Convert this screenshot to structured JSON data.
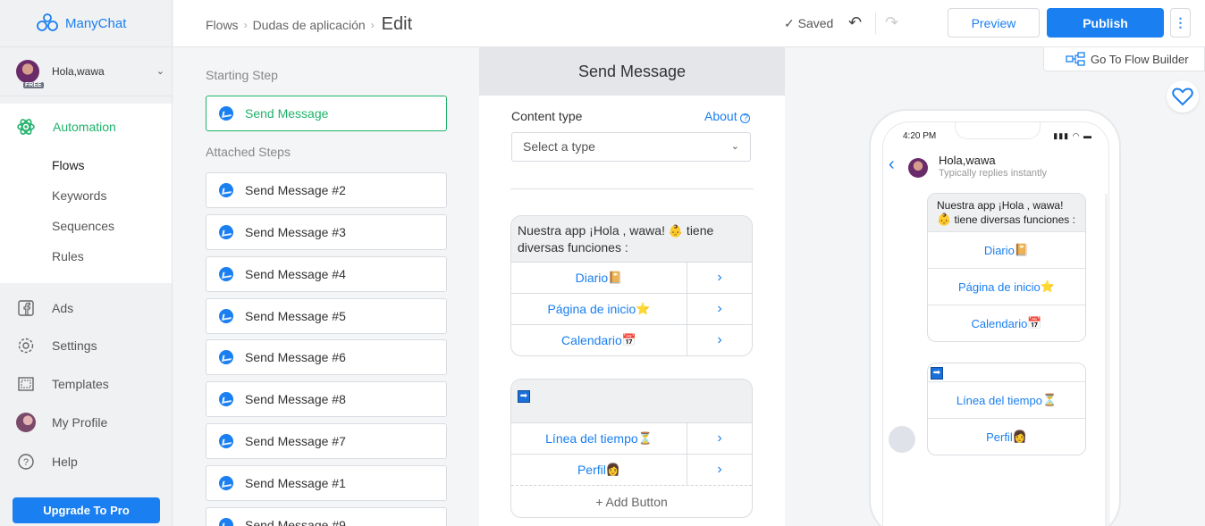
{
  "app": {
    "name": "ManyChat"
  },
  "account": {
    "name": "Hola,wawa",
    "plan_badge": "FREE"
  },
  "sidebar": {
    "automation": {
      "label": "Automation",
      "items": [
        {
          "label": "Flows"
        },
        {
          "label": "Keywords"
        },
        {
          "label": "Sequences"
        },
        {
          "label": "Rules"
        }
      ]
    },
    "items": [
      {
        "label": "Ads"
      },
      {
        "label": "Settings"
      },
      {
        "label": "Templates"
      },
      {
        "label": "My Profile"
      },
      {
        "label": "Help"
      }
    ],
    "upgrade_label": "Upgrade To Pro"
  },
  "topbar": {
    "breadcrumb": [
      "Flows",
      "Dudas de aplicación"
    ],
    "page_title": "Edit",
    "status": "Saved",
    "preview_label": "Preview",
    "publish_label": "Publish",
    "flow_builder_label": "Go To Flow Builder"
  },
  "steps": {
    "starting_label": "Starting Step",
    "starting_step": "Send Message",
    "attached_label": "Attached Steps",
    "attached": [
      "Send Message #2",
      "Send Message #3",
      "Send Message #4",
      "Send Message #5",
      "Send Message #6",
      "Send Message #8",
      "Send Message #7",
      "Send Message #1",
      "Send Message #9"
    ]
  },
  "editor": {
    "title": "Send Message",
    "content_type_label": "Content type",
    "about_label": "About",
    "select_placeholder": "Select a type",
    "card1": {
      "text_a": "Nuestra app ¡Hola , wawa! ",
      "text_emoji": "👶",
      "text_b": " tiene diversas funciones :",
      "buttons": [
        {
          "label": "Diario",
          "emoji": "📔"
        },
        {
          "label": "Página de inicio",
          "emoji": "⭐"
        },
        {
          "label": "Calendario",
          "emoji": "📅"
        }
      ]
    },
    "card2": {
      "text": "➡",
      "buttons": [
        {
          "label": "Línea del tiempo",
          "emoji": "⏳"
        },
        {
          "label": "Perfil",
          "emoji": "👩"
        }
      ],
      "add_button_label": "+ Add Button"
    }
  },
  "phone": {
    "time": "4:20 PM",
    "contact_name": "Hola,wawa",
    "contact_status": "Typically replies instantly",
    "message1": {
      "text_a": "Nuestra app ¡Hola , wawa!",
      "text_emoji": "👶",
      "text_b": " tiene diversas funciones :",
      "buttons": [
        {
          "label": "Diario",
          "emoji": "📔"
        },
        {
          "label": "Página de inicio",
          "emoji": "⭐"
        },
        {
          "label": "Calendario",
          "emoji": "📅"
        }
      ]
    },
    "message2": {
      "text": "➡",
      "buttons": [
        {
          "label": "Línea del tiempo",
          "emoji": "⏳"
        },
        {
          "label": "Perfil",
          "emoji": "👩"
        }
      ]
    }
  },
  "colors": {
    "brand": "#1a7ff0",
    "accent_green": "#20b26b"
  }
}
